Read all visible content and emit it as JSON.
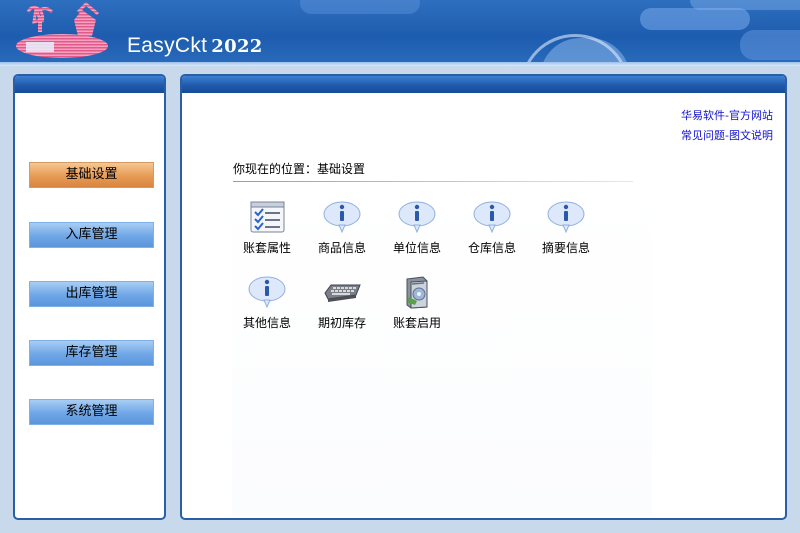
{
  "header": {
    "app_name": "EasyCkt",
    "app_year": "2022"
  },
  "sidebar": {
    "items": [
      {
        "label": "基础设置",
        "active": true
      },
      {
        "label": "入库管理",
        "active": false
      },
      {
        "label": "出库管理",
        "active": false
      },
      {
        "label": "库存管理",
        "active": false
      },
      {
        "label": "系统管理",
        "active": false
      }
    ]
  },
  "links": {
    "official_site": "华易软件-官方网站",
    "faq": "常见问题-图文说明"
  },
  "location": {
    "prefix": "你现在的位置：",
    "current": "基础设置"
  },
  "functions": [
    {
      "label": "账套属性",
      "icon": "checklist-icon"
    },
    {
      "label": "商品信息",
      "icon": "info-bubble-icon"
    },
    {
      "label": "单位信息",
      "icon": "info-bubble-icon"
    },
    {
      "label": "仓库信息",
      "icon": "info-bubble-icon"
    },
    {
      "label": "摘要信息",
      "icon": "info-bubble-icon"
    },
    {
      "label": "其他信息",
      "icon": "info-bubble-icon"
    },
    {
      "label": "期初库存",
      "icon": "keyboard-icon"
    },
    {
      "label": "账套启用",
      "icon": "software-box-icon"
    }
  ],
  "colors": {
    "active_menu": "#e69a55",
    "menu": "#6fa6e6",
    "panel_border": "#2a5fa6",
    "link": "#1010d0"
  }
}
